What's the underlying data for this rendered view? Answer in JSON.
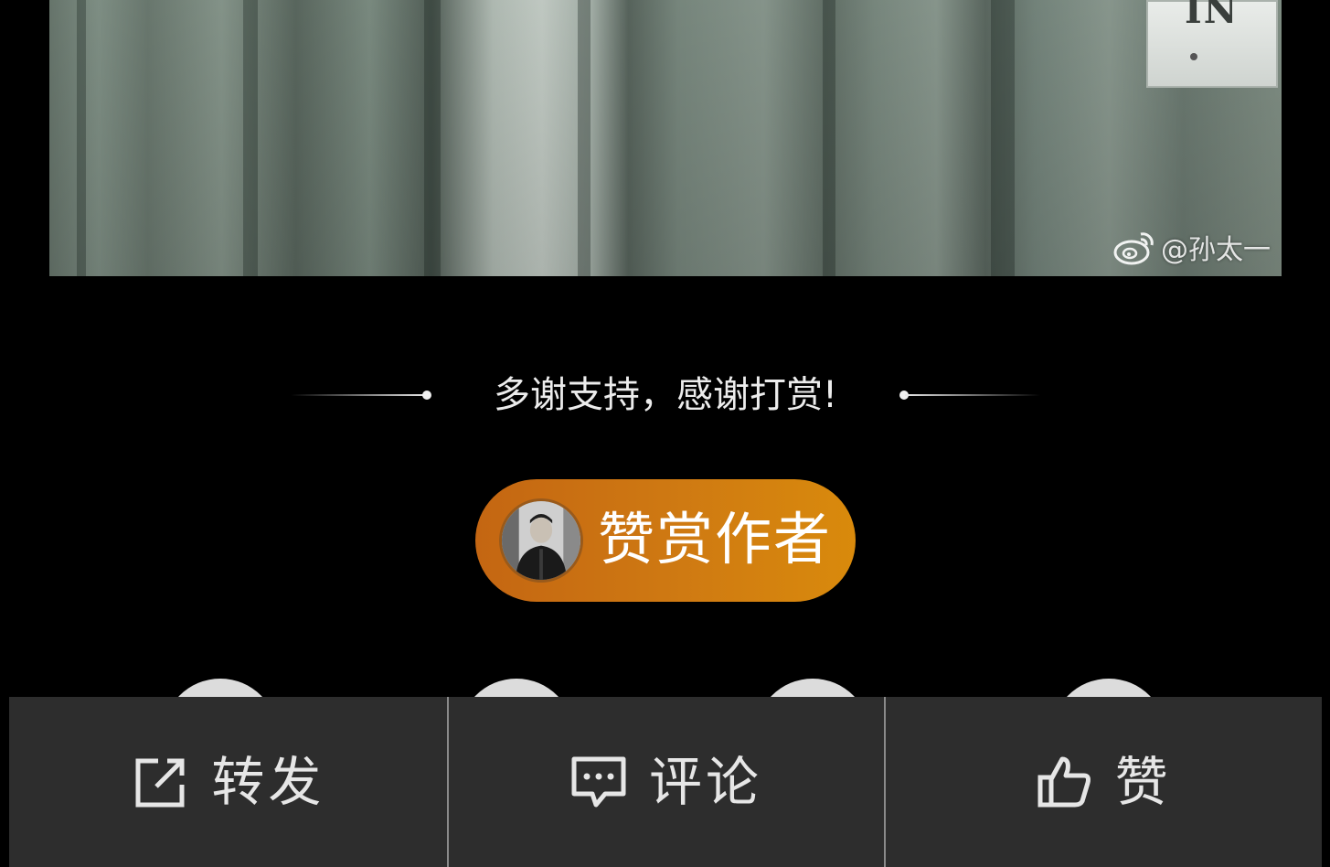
{
  "media": {
    "watermark_text": "@孙太一",
    "sign_glyphs": "IN"
  },
  "thanks": {
    "text": "多谢支持，感谢打赏!"
  },
  "reward": {
    "label": "赞赏作者"
  },
  "action_bar": {
    "forward_label": "转发",
    "comment_label": "评论",
    "like_label": "赞"
  },
  "colors": {
    "reward_gradient_start": "#c46612",
    "reward_gradient_end": "#d98a0c",
    "action_bar_bg": "#2d2d2d",
    "divider": "#8a8a8a"
  }
}
